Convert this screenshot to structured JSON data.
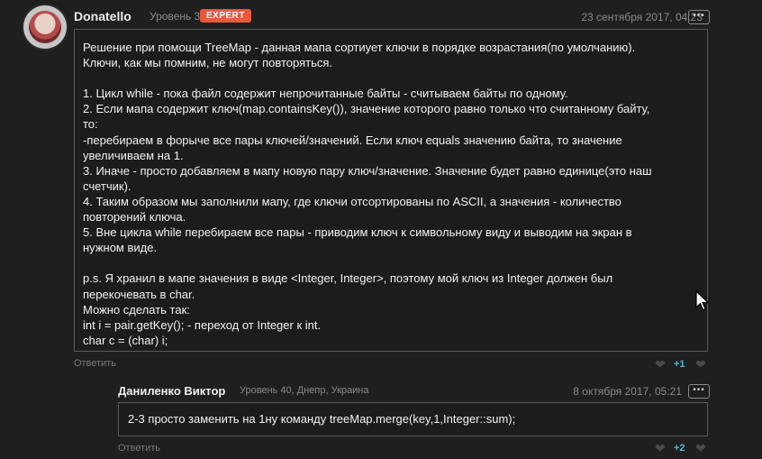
{
  "comment1": {
    "username": "Donatello",
    "level": "Уровень 32",
    "badge": "EXPERT",
    "date": "23 сентября 2017, 04:23",
    "more": "•••",
    "lines": [
      "Решение при помощи TreeMap - данная мапа сортиует ключи в порядке возрастания(по умолчанию).",
      "Ключи, как мы помним, не могут повторяться.",
      "",
      "1. Цикл while - пока файл содержит непрочитанные байты - считываем байты по одному.",
      "2. Если мапа содержит ключ(map.containsKey()), значение которого равно только что считанному байту,",
      "то:",
      "-перебираем в форыче все пары ключей/значений. Если ключ equals значению байта, то значение",
      "увеличиваем на 1.",
      "3. Иначе - просто добавляем в мапу новую пару ключ/значение. Значение будет равно единице(это наш",
      "счетчик).",
      "4. Таким образом мы заполнили мапу, где ключи отсортированы по ASCII, а значения - количество",
      "повторений ключа.",
      "5. Вне цикла while перебираем все пары  - приводим ключ к символьному виду и выводим на экран в",
      "нужном виде.",
      "",
      "p.s. Я хранил в мапе значения в виде <Integer, Integer>, поэтому мой ключ из Integer должен был",
      "перекочевать в char.",
      "Можно сделать так:",
      "int i = pair.getKey(); - переход от Integer к int.",
      "char c = (char) i;"
    ],
    "reply": "Ответить",
    "score": "+1"
  },
  "comment2": {
    "username": "Даниленко Виктор",
    "level": "Уровень 40, Днепр, Украина",
    "date": "8 октября 2017, 05:21",
    "more": "•••",
    "text": "2-3 просто заменить на 1ну команду treeMap.merge(key,1,Integer::sum);",
    "reply": "Ответить",
    "score": "+2"
  },
  "icons": {
    "avatar": "avatar-image",
    "like": "heart-icon",
    "dislike": "heart-icon",
    "cursor": "mouse-pointer-icon"
  },
  "colors": {
    "badge": "#e8593d",
    "score": "#5ab2d8",
    "background": "#1f1f1f"
  }
}
